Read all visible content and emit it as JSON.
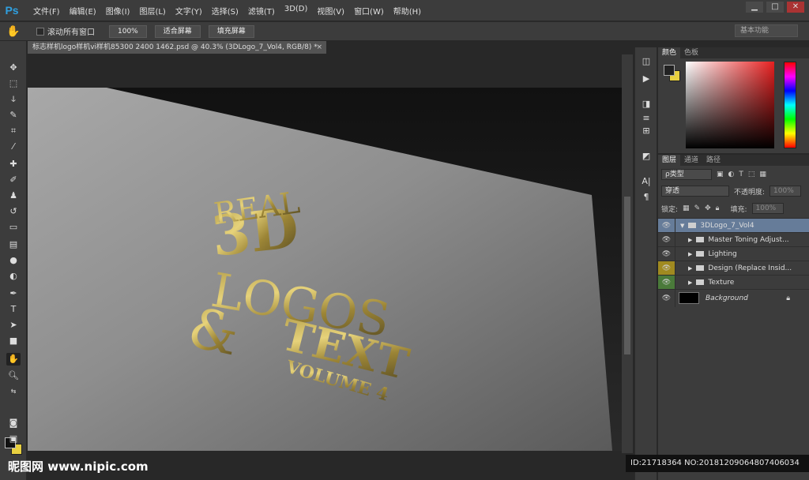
{
  "app": {
    "logo": "Ps"
  },
  "menu": [
    "文件(F)",
    "编辑(E)",
    "图像(I)",
    "图层(L)",
    "文字(Y)",
    "选择(S)",
    "滤镜(T)",
    "3D(D)",
    "视图(V)",
    "窗口(W)",
    "帮助(H)"
  ],
  "window_controls": {
    "minimize": "▁",
    "maximize": "□",
    "close": "✕"
  },
  "options": {
    "scroll_all_label": "滚动所有窗口",
    "btn_100": "100%",
    "btn_fit": "适合屏幕",
    "btn_fill": "填充屏幕",
    "workspace": "基本功能"
  },
  "document": {
    "tab_title": "标志样机logo样机vi样机85300 2400 1462.psd @ 40.3% (3DLogo_7_Vol4, RGB/8) *",
    "close": "×"
  },
  "artwork": {
    "real": "REAL",
    "three_d": "3D",
    "logos": "LOGOS",
    "amp": "&",
    "text": "TEXT",
    "volume": "VOLUME 4"
  },
  "color_panel": {
    "tabs": [
      "颜色",
      "色板"
    ],
    "fg_color": "#1e1e1e",
    "bg_color": "#e8d040"
  },
  "layers_panel": {
    "tabs": [
      "图层",
      "通道",
      "路径"
    ],
    "filter_kind": "ρ类型",
    "blend_mode": "穿透",
    "opacity_label": "不透明度:",
    "opacity_value": "100%",
    "lock_label": "锁定:",
    "fill_label": "填充:",
    "fill_value": "100%",
    "layers": [
      {
        "name": "3DLogo_7_Vol4",
        "type": "group-open"
      },
      {
        "name": "Master Toning Adjust...",
        "type": "group"
      },
      {
        "name": "Lighting",
        "type": "group"
      },
      {
        "name": "Design (Replace Insid...",
        "type": "group"
      },
      {
        "name": "Texture",
        "type": "group"
      },
      {
        "name": "Background",
        "type": "background"
      }
    ]
  },
  "watermark": {
    "site": "昵图网 www.nipic.com",
    "id_text": "ID:21718364 NO:20181209064807406034"
  }
}
